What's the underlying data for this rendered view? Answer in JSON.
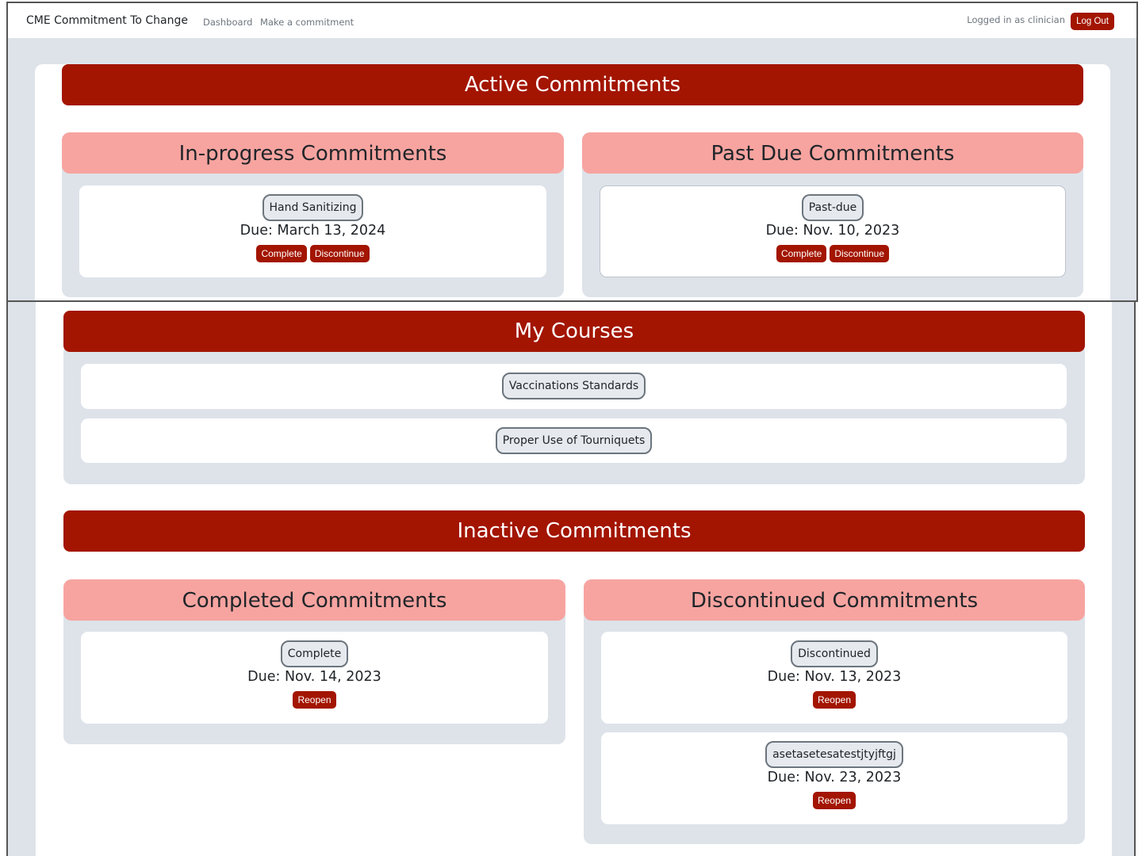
{
  "navbar": {
    "brand": "CME Commitment To Change",
    "links": [
      "Dashboard",
      "Make a commitment"
    ],
    "logged_in_text": "Logged in as clinician",
    "logout_label": "Log Out"
  },
  "active": {
    "title": "Active Commitments",
    "in_progress": {
      "title": "In-progress Commitments",
      "items": [
        {
          "name": "Hand Sanitizing",
          "due": "Due: March 13, 2024",
          "actions": [
            "Complete",
            "Discontinue"
          ]
        }
      ]
    },
    "past_due": {
      "title": "Past Due Commitments",
      "items": [
        {
          "name": "Past-due",
          "due": "Due: Nov. 10, 2023",
          "actions": [
            "Complete",
            "Discontinue"
          ]
        }
      ]
    }
  },
  "courses": {
    "title": "My Courses",
    "items": [
      "Vaccinations Standards",
      "Proper Use of Tourniquets"
    ]
  },
  "inactive": {
    "title": "Inactive Commitments",
    "completed": {
      "title": "Completed Commitments",
      "items": [
        {
          "name": "Complete",
          "due": "Due: Nov. 14, 2023",
          "actions": [
            "Reopen"
          ]
        }
      ]
    },
    "discontinued": {
      "title": "Discontinued Commitments",
      "items": [
        {
          "name": "Discontinued",
          "due": "Due: Nov. 13, 2023",
          "actions": [
            "Reopen"
          ]
        },
        {
          "name": "asetasetesatestjtyjftgj",
          "due": "Due: Nov. 23, 2023",
          "actions": [
            "Reopen"
          ]
        }
      ]
    }
  },
  "colors": {
    "primary_red": "#a31500",
    "pink_header": "#f7a4a0",
    "panel_gray": "#dee3ea"
  }
}
